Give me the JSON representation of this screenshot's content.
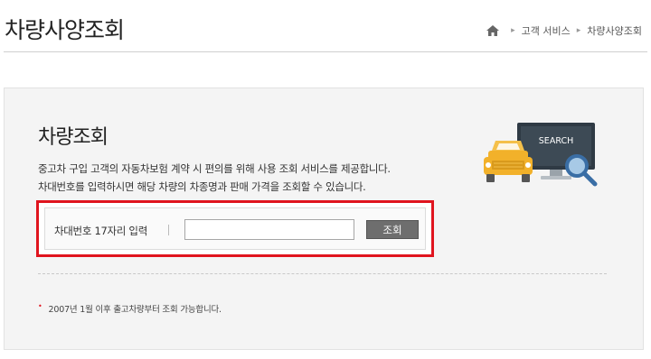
{
  "header": {
    "title": "차량사양조회",
    "breadcrumb": {
      "home_icon": "home-icon",
      "items": [
        "고객 서비스",
        "차량사양조회"
      ]
    }
  },
  "panel": {
    "title": "차량조회",
    "description": [
      "중고차 구입 고객의 자동차보험 계약 시 편의를 위해 사용 조회 서비스를 제공합니다.",
      "차대번호를 입력하시면 해당 차량의 차종명과 판매 가격을 조회할 수 있습니다."
    ],
    "illustration": {
      "monitor_text": "SEARCH",
      "colors": {
        "monitor": "#2f3a44",
        "car": "#f2b12a",
        "magnifier": "#3a6ea5"
      }
    },
    "search": {
      "label": "차대번호 17자리 입력",
      "value": "",
      "button_label": "조회",
      "highlight_color": "#e0141e"
    },
    "note": "2007년 1월 이후 출고차량부터 조회 가능합니다."
  }
}
